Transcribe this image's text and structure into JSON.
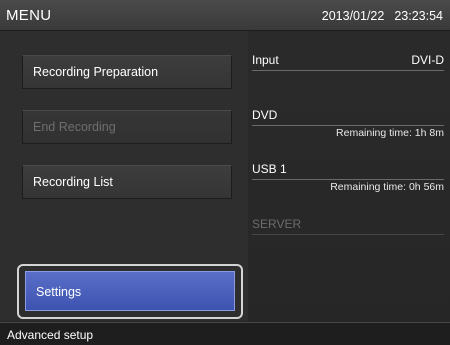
{
  "header": {
    "title": "MENU",
    "date": "2013/01/22",
    "time": "23:23:54"
  },
  "menu": {
    "recording_preparation": "Recording Preparation",
    "end_recording": "End Recording",
    "recording_list": "Recording List",
    "settings": "Settings"
  },
  "status": {
    "input": {
      "label": "Input",
      "value": "DVI-D"
    },
    "dvd": {
      "label": "DVD",
      "remaining": "Remaining time: 1h 8m"
    },
    "usb1": {
      "label": "USB 1",
      "remaining": "Remaining time: 0h 56m"
    },
    "server": {
      "label": "SERVER"
    }
  },
  "footer": {
    "hint": "Advanced setup"
  },
  "colors": {
    "selected_accent": "#4a5fbd",
    "disabled_text": "#6e6e6e"
  }
}
